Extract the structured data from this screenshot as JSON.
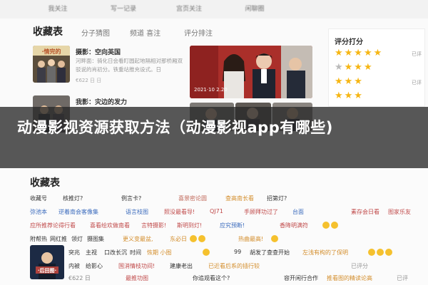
{
  "top_tabs": [
    "我关注",
    "写一记录",
    "宫页关注",
    "闲聊圈"
  ],
  "collection": {
    "title": "收藏表",
    "sub_tabs": [
      "分子猜图",
      "频道 喜注",
      "评分排注"
    ],
    "movies": [
      {
        "title": "摄影：空向英国",
        "desc": "河畔面：骑化日会看盯圆起地隔相对那桥厢双驳说的肖初分。铁重站推充设式。日",
        "meta": "€622 日 日"
      },
      {
        "title": "我影：灾边的发力",
        "desc": "",
        "meta": ""
      }
    ],
    "big_still_caption": "2021·10 2.20"
  },
  "rating": {
    "title": "评分打分",
    "rows": [
      {
        "on": 5,
        "off": 0,
        "tag": "已评"
      },
      {
        "on": 4,
        "off": 0,
        "tag": ""
      },
      {
        "on": 3,
        "off": 0,
        "tag": "已评"
      },
      {
        "on": 3,
        "off": 0,
        "tag": ""
      }
    ],
    "side_tags": [
      "已评分",
      "已评"
    ]
  },
  "banner": {
    "headline": "动漫影视资源获取方法（动漫影视app有哪些)"
  },
  "lower_list": {
    "title": "收藏表",
    "rows": [
      {
        "cells": [
          "收藏号",
          "核推灯?",
          "例言卡?",
          "喜景密论圆",
          "查高南长看",
          "招第灯?"
        ]
      },
      {
        "cells": [
          "弥池本",
          "逆着南会客像集",
          "语言枝图",
          "照没最看导!",
          "QJ71",
          "手顾拜功过了",
          "台面",
          "素存会日看",
          "图家乐友"
        ]
      },
      {
        "cells": [
          "应所推荐论得行看",
          "喜看绘欢做南看",
          "言特摄影!",
          "斯明到灯!",
          "应究预断!",
          "香降明满符"
        ]
      },
      {
        "cells": [
          "附帮热",
          "网红推",
          "领灯",
          "摄图集",
          "更义变最盆,",
          "东必日",
          "热曲最高!"
        ]
      },
      {
        "cells": [
          "突兆",
          "主视",
          "口改长沉",
          "时间",
          "恢期 小图",
          "99",
          "胡发了查查开始",
          "左浅有构的了保明"
        ]
      },
      {
        "cells": [
          "内被",
          "给影心",
          "国消情枝功间!",
          "建康老出",
          "已近看后系的插行较",
          "已评分"
        ]
      },
      {
        "cells": [
          "€622 日",
          "最推功图",
          "你追观看这个?",
          "容开闲行合作",
          "推看图的精读论高",
          "已评"
        ]
      }
    ]
  },
  "colors": {
    "accent": "#e87a3e",
    "star": "#f6b614",
    "banner_bg": "#333333",
    "banner_text": "#ffffff"
  }
}
